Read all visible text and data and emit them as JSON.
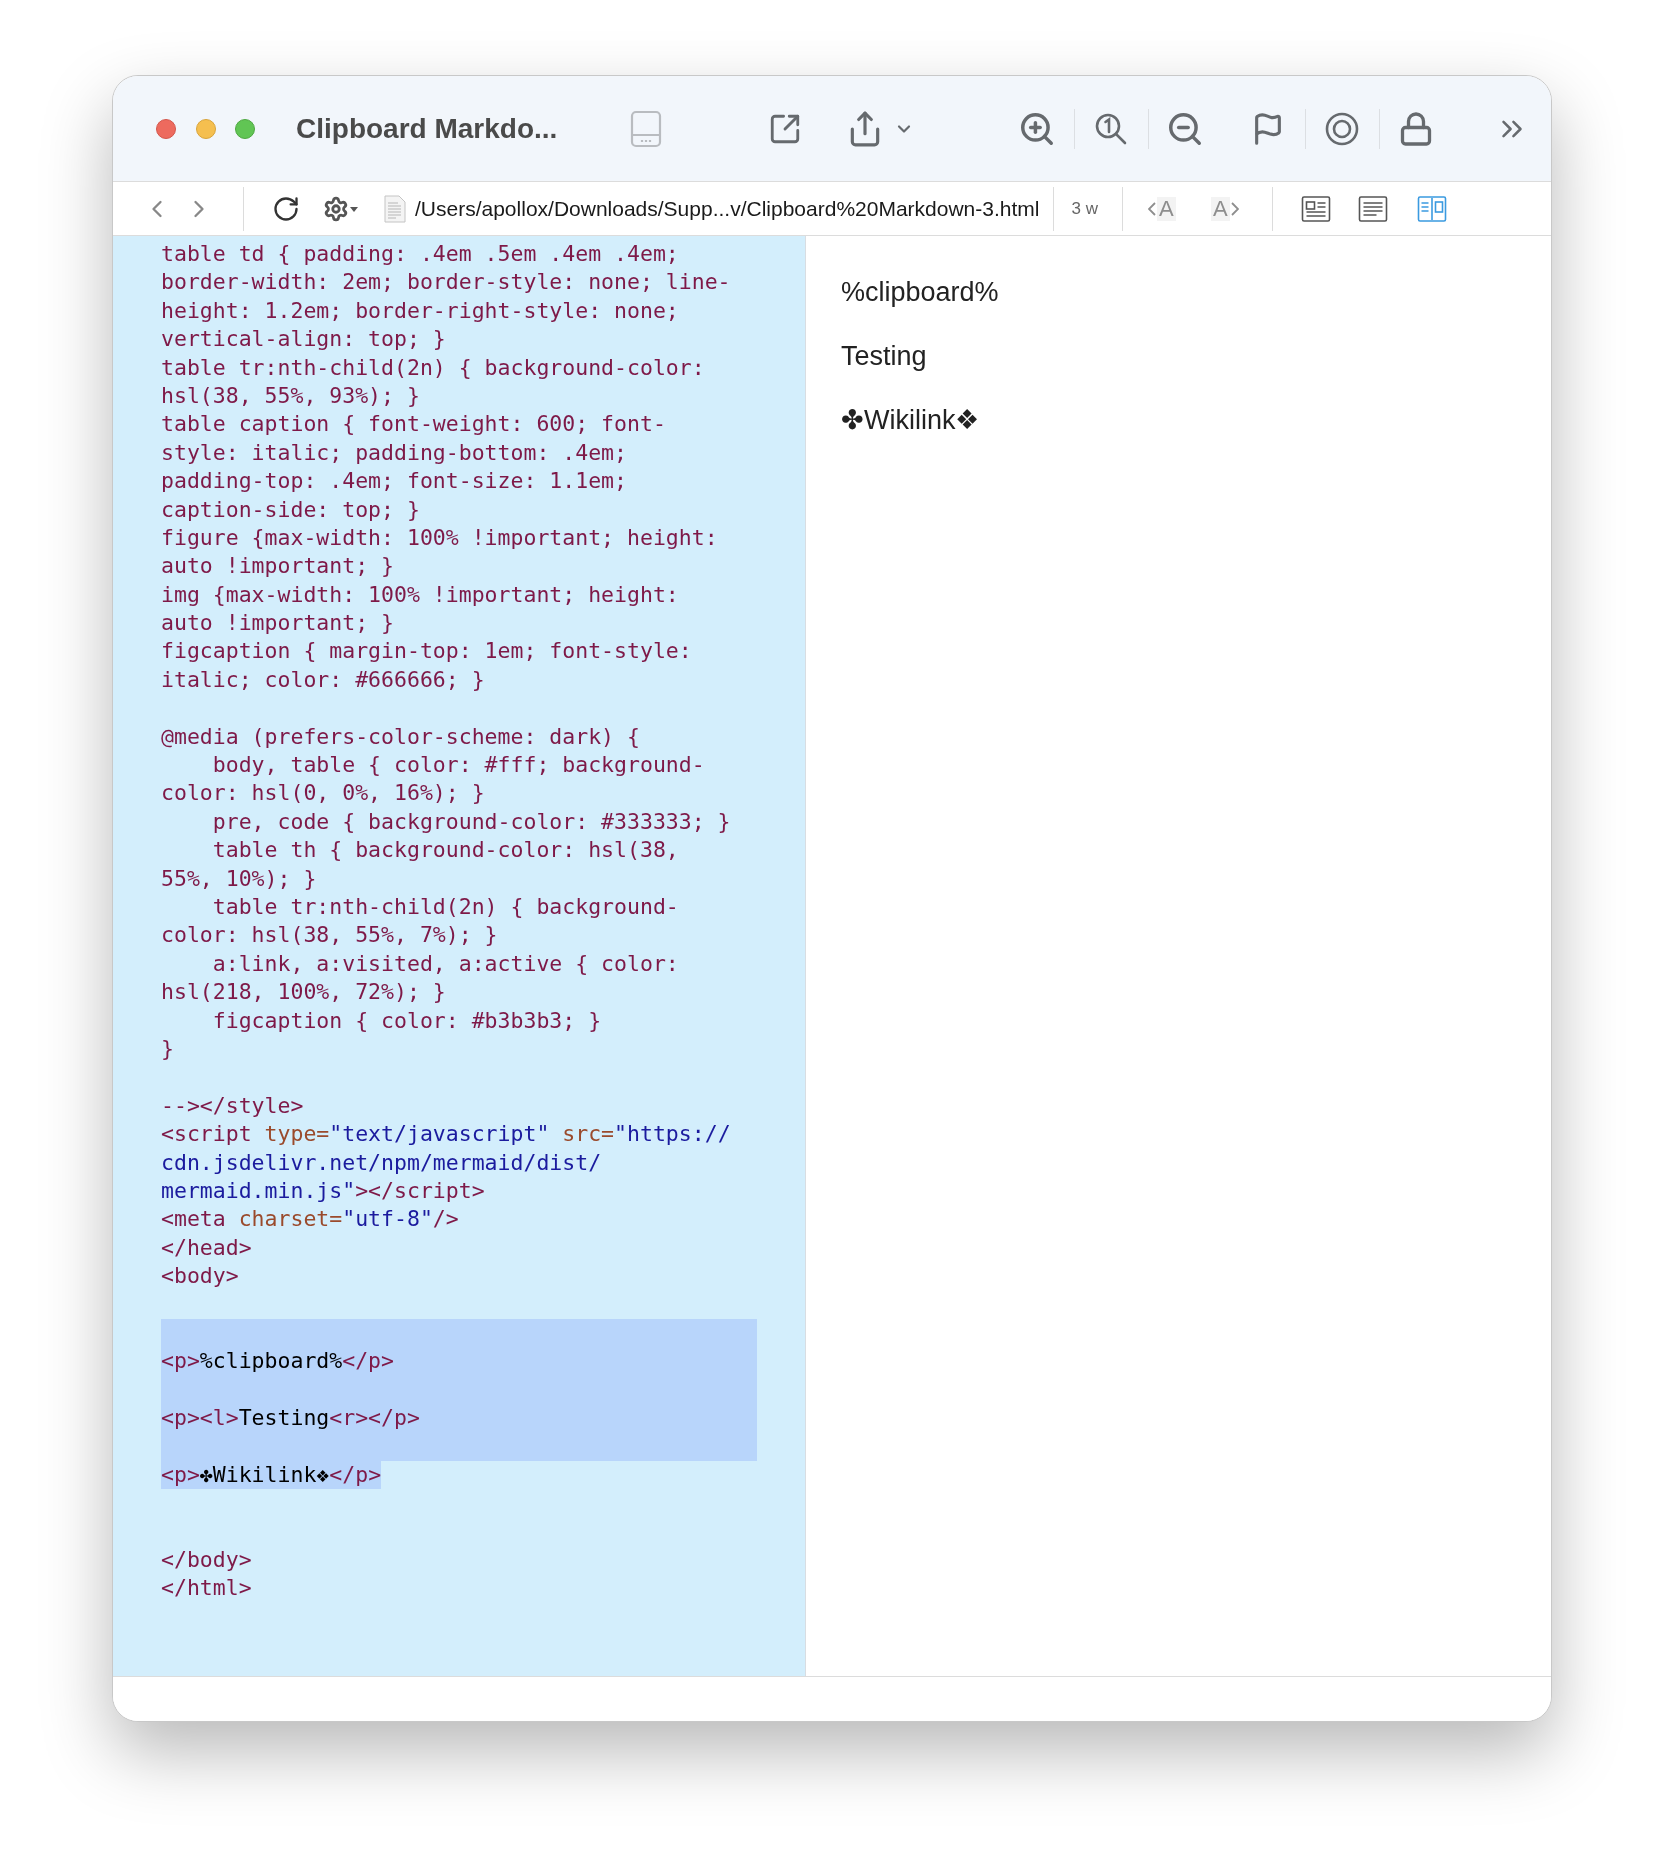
{
  "window": {
    "title": "Clipboard Markdo..."
  },
  "toolbar": [
    {
      "kind": "sidebar",
      "disabled": true
    },
    {
      "kind": "external",
      "disabled": false
    },
    {
      "kind": "share",
      "disabled": false
    },
    {
      "kind": "share-menu",
      "disabled": false
    },
    {
      "kind": "zoom-in",
      "disabled": false
    },
    {
      "kind": "separator"
    },
    {
      "kind": "actual-size",
      "disabled": false
    },
    {
      "kind": "separator"
    },
    {
      "kind": "zoom-out",
      "disabled": false
    },
    {
      "kind": "flag",
      "disabled": false
    },
    {
      "kind": "separator"
    },
    {
      "kind": "target",
      "disabled": false
    },
    {
      "kind": "separator"
    },
    {
      "kind": "lock",
      "disabled": false
    },
    {
      "kind": "more",
      "disabled": false
    }
  ],
  "navbar": {
    "path": "/Users/apollox/Downloads/Supp...v/Clipboard%20Markdown-3.html",
    "word_count": "3 w",
    "font_buttons": [
      {
        "kind": "smaller",
        "label": "A",
        "disabled": true
      },
      {
        "kind": "larger",
        "label": "A",
        "disabled": true
      }
    ],
    "views": [
      {
        "kind": "card",
        "selected": false
      },
      {
        "kind": "text",
        "selected": false
      },
      {
        "kind": "split",
        "selected": true
      }
    ]
  },
  "source": {
    "lines": [
      {
        "kind": "code",
        "selected": false,
        "segments": [
          {
            "kind": "markup",
            "text": "table td { padding: .4em .5em .4em .4em;"
          }
        ]
      },
      {
        "kind": "code",
        "selected": false,
        "segments": [
          {
            "kind": "markup",
            "text": "border-width: 2em; border-style: none; line-"
          }
        ]
      },
      {
        "kind": "code",
        "selected": false,
        "segments": [
          {
            "kind": "markup",
            "text": "height: 1.2em; border-right-style: none;"
          }
        ]
      },
      {
        "kind": "code",
        "selected": false,
        "segments": [
          {
            "kind": "markup",
            "text": "vertical-align: top; }"
          }
        ]
      },
      {
        "kind": "code",
        "selected": false,
        "segments": [
          {
            "kind": "markup",
            "text": "table tr:nth-child(2n) { background-color:"
          }
        ]
      },
      {
        "kind": "code",
        "selected": false,
        "segments": [
          {
            "kind": "markup",
            "text": "hsl(38, 55%, 93%); }"
          }
        ]
      },
      {
        "kind": "code",
        "selected": false,
        "segments": [
          {
            "kind": "markup",
            "text": "table caption { font-weight: 600; font-"
          }
        ]
      },
      {
        "kind": "code",
        "selected": false,
        "segments": [
          {
            "kind": "markup",
            "text": "style: italic; padding-bottom: .4em;"
          }
        ]
      },
      {
        "kind": "code",
        "selected": false,
        "segments": [
          {
            "kind": "markup",
            "text": "padding-top: .4em; font-size: 1.1em;"
          }
        ]
      },
      {
        "kind": "code",
        "selected": false,
        "segments": [
          {
            "kind": "markup",
            "text": "caption-side: top; }"
          }
        ]
      },
      {
        "kind": "code",
        "selected": false,
        "segments": [
          {
            "kind": "markup",
            "text": "figure {max-width: 100% !important; height:"
          }
        ]
      },
      {
        "kind": "code",
        "selected": false,
        "segments": [
          {
            "kind": "markup",
            "text": "auto !important; }"
          }
        ]
      },
      {
        "kind": "code",
        "selected": false,
        "segments": [
          {
            "kind": "markup",
            "text": "img {max-width: 100% !important; height:"
          }
        ]
      },
      {
        "kind": "code",
        "selected": false,
        "segments": [
          {
            "kind": "markup",
            "text": "auto !important; }"
          }
        ]
      },
      {
        "kind": "code",
        "selected": false,
        "segments": [
          {
            "kind": "markup",
            "text": "figcaption { margin-top: 1em; font-style:"
          }
        ]
      },
      {
        "kind": "code",
        "selected": false,
        "segments": [
          {
            "kind": "markup",
            "text": "italic; color: #666666; }"
          }
        ]
      },
      {
        "kind": "blank",
        "selected": false
      },
      {
        "kind": "code",
        "selected": false,
        "segments": [
          {
            "kind": "markup",
            "text": "@media (prefers-color-scheme: dark) {"
          }
        ]
      },
      {
        "kind": "code",
        "selected": false,
        "segments": [
          {
            "kind": "markup",
            "text": "    body, table { color: #fff; background-"
          }
        ]
      },
      {
        "kind": "code",
        "selected": false,
        "segments": [
          {
            "kind": "markup",
            "text": "color: hsl(0, 0%, 16%); }"
          }
        ]
      },
      {
        "kind": "code",
        "selected": false,
        "segments": [
          {
            "kind": "markup",
            "text": "    pre, code { background-color: #333333; }"
          }
        ]
      },
      {
        "kind": "code",
        "selected": false,
        "segments": [
          {
            "kind": "markup",
            "text": "    table th { background-color: hsl(38,"
          }
        ]
      },
      {
        "kind": "code",
        "selected": false,
        "segments": [
          {
            "kind": "markup",
            "text": "55%, 10%); }"
          }
        ]
      },
      {
        "kind": "code",
        "selected": false,
        "segments": [
          {
            "kind": "markup",
            "text": "    table tr:nth-child(2n) { background-"
          }
        ]
      },
      {
        "kind": "code",
        "selected": false,
        "segments": [
          {
            "kind": "markup",
            "text": "color: hsl(38, 55%, 7%); }"
          }
        ]
      },
      {
        "kind": "code",
        "selected": false,
        "segments": [
          {
            "kind": "markup",
            "text": "    a:link, a:visited, a:active { color:"
          }
        ]
      },
      {
        "kind": "code",
        "selected": false,
        "segments": [
          {
            "kind": "markup",
            "text": "hsl(218, 100%, 72%); }"
          }
        ]
      },
      {
        "kind": "code",
        "selected": false,
        "segments": [
          {
            "kind": "markup",
            "text": "    figcaption { color: #b3b3b3; }"
          }
        ]
      },
      {
        "kind": "code",
        "selected": false,
        "segments": [
          {
            "kind": "markup",
            "text": "}"
          }
        ]
      },
      {
        "kind": "blank",
        "selected": false
      },
      {
        "kind": "code",
        "selected": false,
        "segments": [
          {
            "kind": "markup",
            "text": "--></style>"
          }
        ]
      },
      {
        "kind": "code",
        "selected": false,
        "segments": [
          {
            "kind": "markup",
            "text": "<script"
          },
          {
            "kind": "attr",
            "text": " type="
          },
          {
            "kind": "value",
            "text": "\"text/javascript\""
          },
          {
            "kind": "attr",
            "text": " src="
          },
          {
            "kind": "value",
            "text": "\"https://"
          }
        ]
      },
      {
        "kind": "code",
        "selected": false,
        "segments": [
          {
            "kind": "value",
            "text": "cdn.jsdelivr.net/npm/mermaid/dist/"
          }
        ]
      },
      {
        "kind": "code",
        "selected": false,
        "segments": [
          {
            "kind": "value",
            "text": "mermaid.min.js\""
          },
          {
            "kind": "markup",
            "text": "></script>"
          }
        ]
      },
      {
        "kind": "code",
        "selected": false,
        "segments": [
          {
            "kind": "markup",
            "text": "<meta"
          },
          {
            "kind": "attr",
            "text": " charset="
          },
          {
            "kind": "value",
            "text": "\"utf-8\""
          },
          {
            "kind": "markup",
            "text": "/>"
          }
        ]
      },
      {
        "kind": "code",
        "selected": false,
        "segments": [
          {
            "kind": "markup",
            "text": "</head>"
          }
        ]
      },
      {
        "kind": "code",
        "selected": false,
        "segments": [
          {
            "kind": "markup",
            "text": "<body>"
          }
        ]
      },
      {
        "kind": "blank",
        "selected": false
      },
      {
        "kind": "blank",
        "selected": true,
        "full_width": true
      },
      {
        "kind": "code",
        "selected": true,
        "full_width": true,
        "segments": [
          {
            "kind": "markup",
            "text": "<p>"
          },
          {
            "kind": "text",
            "text": "%clipboard%"
          },
          {
            "kind": "markup",
            "text": "</p>"
          }
        ]
      },
      {
        "kind": "blank",
        "selected": true,
        "full_width": true
      },
      {
        "kind": "code",
        "selected": true,
        "full_width": true,
        "segments": [
          {
            "kind": "markup",
            "text": "<p><l>"
          },
          {
            "kind": "text",
            "text": "Testing"
          },
          {
            "kind": "markup",
            "text": "<r></p>"
          }
        ]
      },
      {
        "kind": "blank",
        "selected": true,
        "full_width": true
      },
      {
        "kind": "code",
        "selected": true,
        "full_width": false,
        "segments": [
          {
            "kind": "markup",
            "text": "<p>"
          },
          {
            "kind": "text",
            "text": "✤Wikilink❖"
          },
          {
            "kind": "markup",
            "text": "</p>"
          }
        ]
      },
      {
        "kind": "blank",
        "selected": false
      },
      {
        "kind": "blank",
        "selected": false
      },
      {
        "kind": "code",
        "selected": false,
        "segments": [
          {
            "kind": "markup",
            "text": "</body>"
          }
        ]
      },
      {
        "kind": "code",
        "selected": false,
        "segments": [
          {
            "kind": "markup",
            "text": "</html>"
          }
        ]
      }
    ]
  },
  "preview": {
    "paragraphs": [
      "%clipboard%",
      "Testing",
      "✤Wikilink❖"
    ]
  }
}
